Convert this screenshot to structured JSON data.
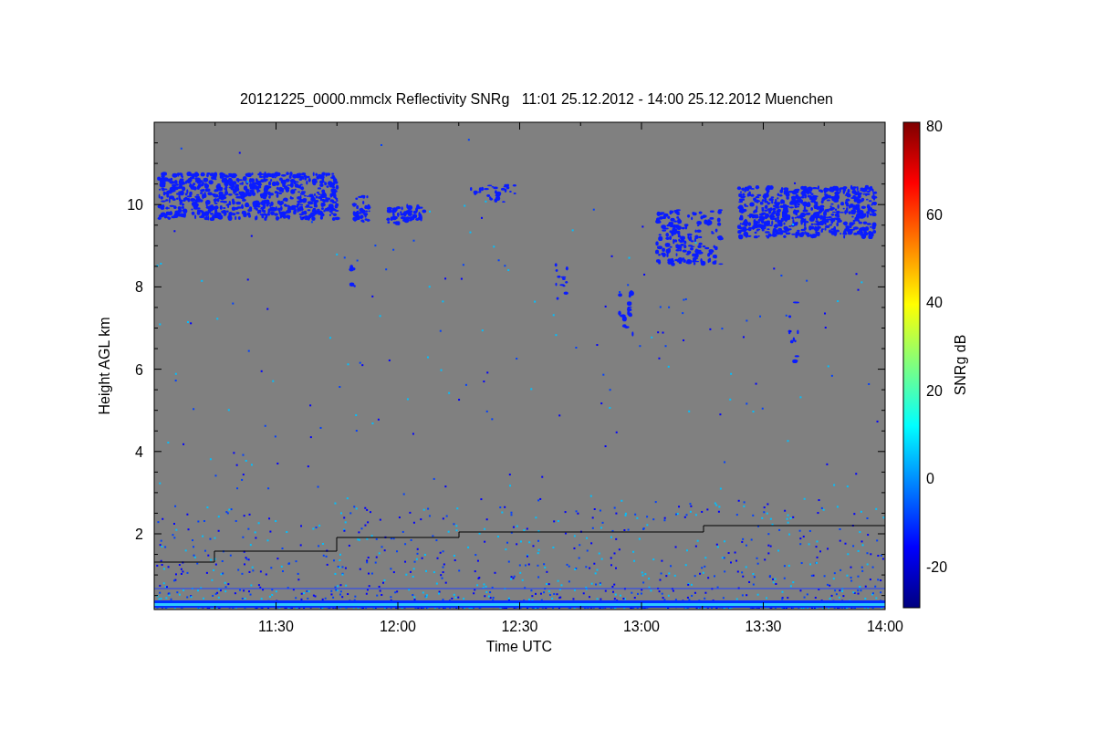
{
  "title": "20121225_0000.mmclx Reflectivity SNRg   11:01 25.12.2012 - 14:00 25.12.2012 Muenchen",
  "y_axis": {
    "label": "Height AGL km",
    "ticks": [
      "10",
      "8",
      "6",
      "4",
      "2"
    ]
  },
  "x_axis": {
    "label": "Time UTC",
    "ticks": [
      "11:30",
      "12:00",
      "12:30",
      "13:00",
      "13:30",
      "14:00"
    ]
  },
  "colorbar": {
    "label": "SNRg dB",
    "ticks": [
      "80",
      "60",
      "40",
      "20",
      "0",
      "-20"
    ]
  }
}
